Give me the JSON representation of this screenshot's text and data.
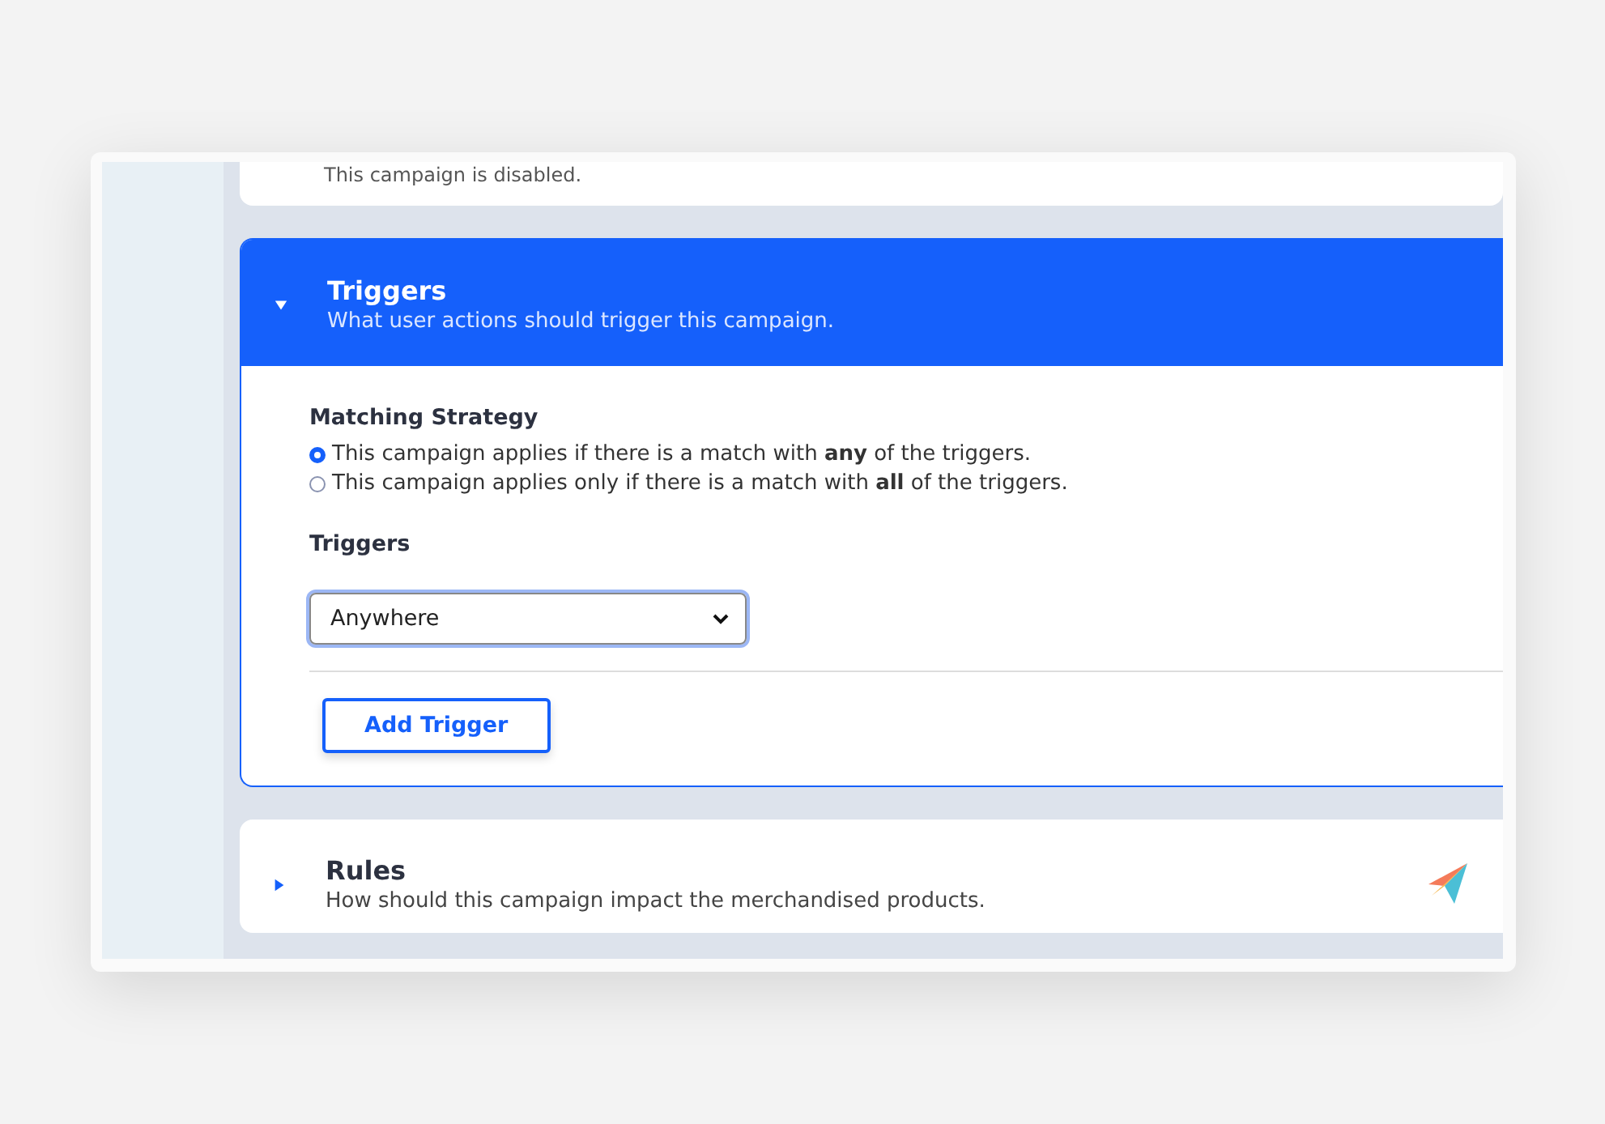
{
  "previous_section": {
    "description": "This campaign is disabled."
  },
  "triggers_section": {
    "title": "Triggers",
    "description": "What user actions should trigger this campaign.",
    "expanded": true,
    "matching_strategy": {
      "label": "Matching Strategy",
      "options": [
        {
          "text": "This campaign applies if there is a match with **any** of the triggers.",
          "selected": true
        },
        {
          "text": "This campaign applies only if there is a match with **all** of the triggers.",
          "selected": false
        }
      ]
    },
    "triggers_label": "Triggers",
    "trigger_select": {
      "value": "Anywhere"
    },
    "add_button": "Add Trigger"
  },
  "rules_section": {
    "title": "Rules",
    "description": "How should this campaign impact the merchandised products.",
    "expanded": false
  }
}
